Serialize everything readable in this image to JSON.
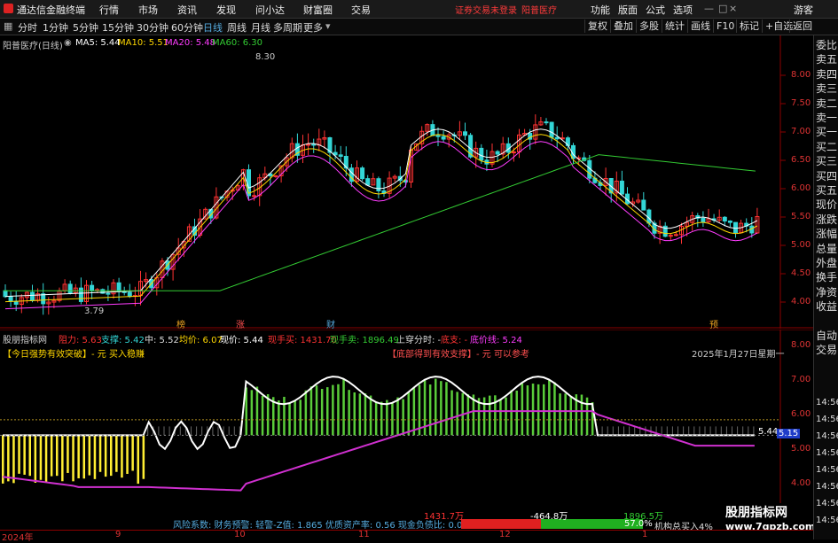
{
  "titlebar": {
    "app_title": "通达信金融终端",
    "menus": [
      "行情",
      "市场",
      "资讯",
      "发现",
      "问小达",
      "财富圈",
      "交易"
    ],
    "warning": "证券交易未登录",
    "stock": "阳普医疗",
    "right_menus": [
      "功能",
      "版面",
      "公式",
      "选项"
    ],
    "guest": "游客"
  },
  "toolbar": {
    "periods": [
      "分时",
      "1分钟",
      "5分钟",
      "15分钟",
      "30分钟",
      "60分钟",
      "日线",
      "周线",
      "月线",
      "多周期",
      "更多"
    ],
    "active_period": "日线",
    "right_buttons": [
      "复权",
      "叠加",
      "多股",
      "统计",
      "画线",
      "F10",
      "标记",
      "+自选",
      "返回"
    ]
  },
  "main": {
    "stock_label": "阳普医疗(日线)",
    "ma5": "MA5: 5.44",
    "ma10": "MA10: 5.51",
    "ma20": "MA20: 5.48",
    "ma60": "MA60: 6.30",
    "high_label": "8.30",
    "low_label": "3.79",
    "y_ticks": [
      "8.00",
      "7.50",
      "7.00",
      "6.50",
      "6.00",
      "5.50",
      "5.00",
      "4.50",
      "4.00"
    ],
    "markers": [
      "榜",
      "涨",
      "财",
      "预"
    ],
    "colors": {
      "ma5": "#ffffff",
      "ma10": "#ffd700",
      "ma20": "#ff3cff",
      "ma60": "#33cc33",
      "up": "#ff3333",
      "down": "#33d6d6"
    }
  },
  "indicator": {
    "name": "股朋指标网",
    "resist": "阻力: 5.63",
    "support": "支撑: 5.42",
    "mid": "中: 5.52",
    "avg": "均价: 6.07",
    "price": "现价: 5.44",
    "buy_hand": "现手买: 1431.70",
    "sell_hand": "现手卖: 1896.49",
    "cross_time": "上穿分时: -",
    "bottom": "底支: -",
    "bottom_line": "底价线: 5.24",
    "tip_left": "【今日强势有效突破】- 元 买入稳赚",
    "tip_mid": "【底部得到有效支撑】- 元 可以参考",
    "date_note": "2025年1月27日星期一",
    "y_ticks": [
      "8.00",
      "7.00",
      "6.00",
      "5.00",
      "4.00"
    ],
    "last_label": "5.44",
    "badge": "5.15",
    "bottom_text": "风险系数: 财务预警: 轻警-Z值: 1.865 优质资产率: 0.56 现金负债比: 0.080",
    "bar_left": "1431.7万",
    "bar_mid": "-464.8万",
    "bar_right": "1896.5万",
    "bar_pct": "57.0%",
    "inst_buy": "机构总买入4%",
    "watermark": "股朋指标网",
    "watermark_url": "www.7gpzb.com"
  },
  "right_panel": [
    "委比",
    "卖五",
    "卖四",
    "卖三",
    "卖二",
    "卖一",
    "买一",
    "买二",
    "买三",
    "买四",
    "买五",
    "现价",
    "涨跌",
    "涨幅",
    "总量",
    "外盘",
    "换手",
    "净资",
    "收益",
    "",
    "自动",
    "交易"
  ],
  "right_times": [
    "14:56",
    "14:56",
    "14:56",
    "14:56",
    "14:56",
    "14:56",
    "14:56",
    "14:56"
  ],
  "xaxis": [
    "2024年",
    "9",
    "10",
    "11",
    "12",
    "1"
  ]
}
